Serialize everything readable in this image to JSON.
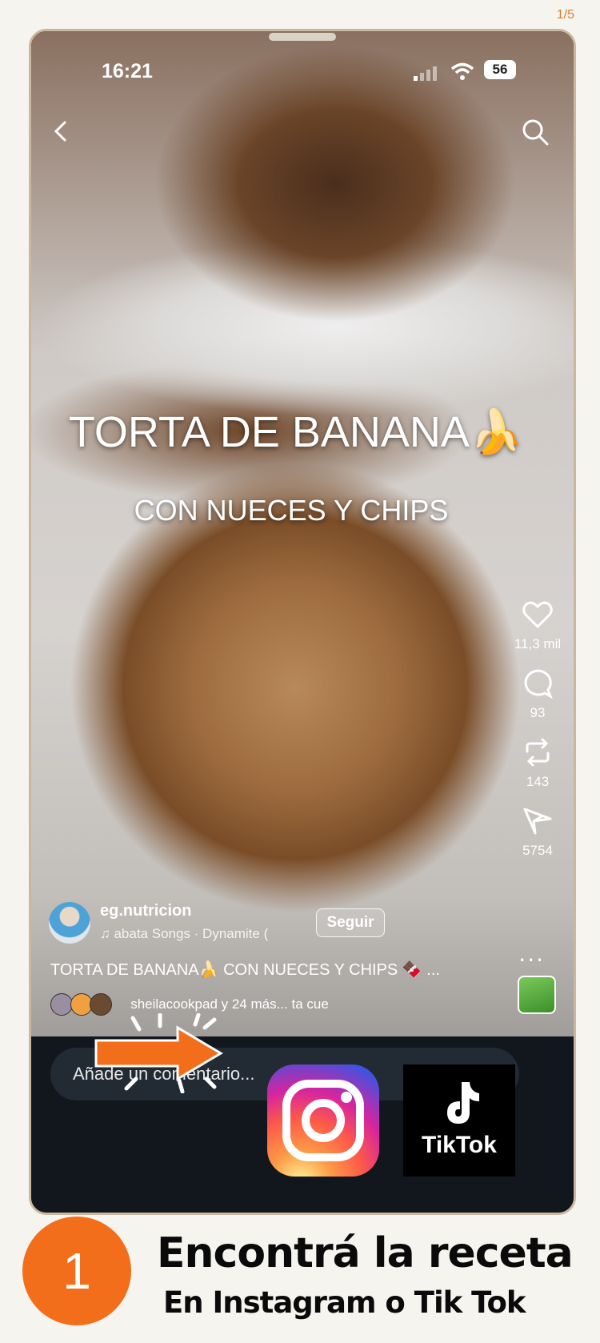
{
  "page_counter": "1/5",
  "status": {
    "time": "16:21",
    "battery": "56"
  },
  "video": {
    "title": "TORTA DE BANANA🍌",
    "subtitle": "CON NUECES Y CHIPS"
  },
  "actions": {
    "likes": "11,3 mil",
    "comments": "93",
    "reposts": "143",
    "shares": "5754",
    "more": "..."
  },
  "author": {
    "name": "eg.nutricion",
    "music": "♫ abata Songs · Dynamite (",
    "follow_label": "Seguir"
  },
  "caption": "TORTA DE BANANA🍌 CON NUECES Y CHIPS 🍫 ...",
  "likers_text": "sheilacookpad y 24 más... ta cue",
  "comment_placeholder": "Añade un comentario...",
  "tiktok_label": "TikTok",
  "step": {
    "number": "1",
    "title": "Encontrá la receta",
    "subtitle": "En Instagram o Tik Tok"
  },
  "colors": {
    "accent": "#f36e1b",
    "app_bg": "#12171d"
  },
  "icons": [
    "back-icon",
    "search-icon",
    "heart-icon",
    "comment-icon",
    "repost-icon",
    "share-icon",
    "instagram-logo",
    "tiktok-logo"
  ]
}
